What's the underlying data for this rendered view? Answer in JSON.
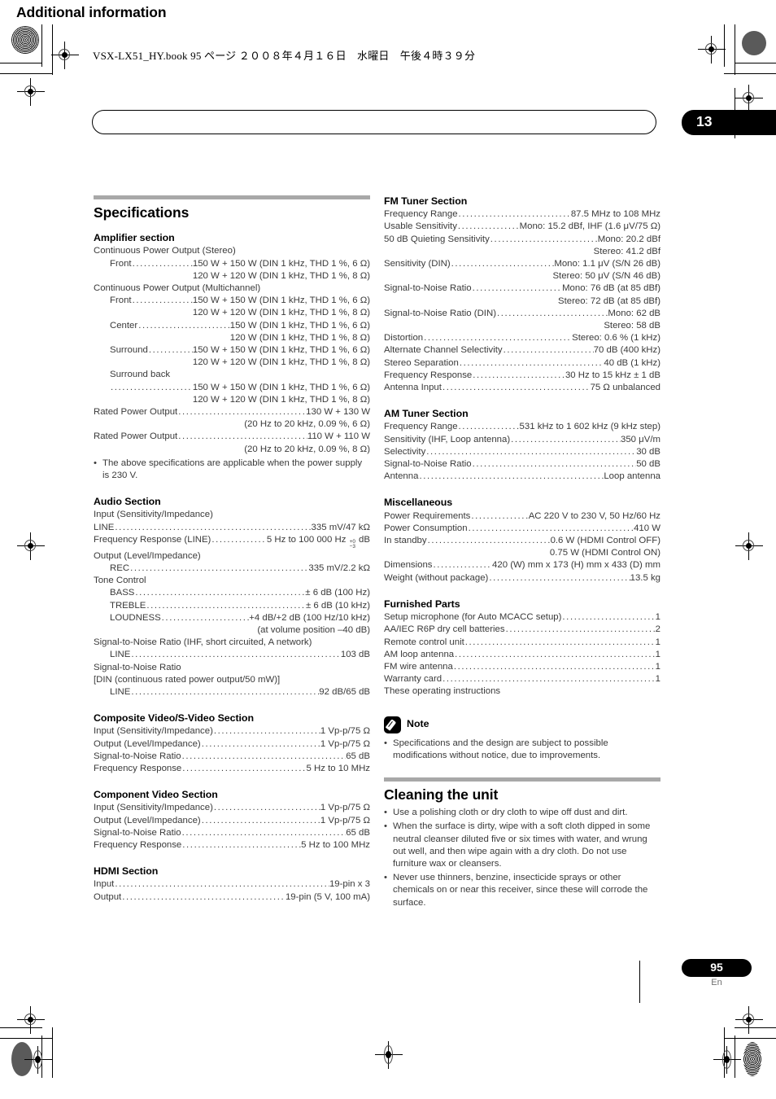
{
  "running_head": "VSX-LX51_HY.book  95 ページ  ２００８年４月１６日　水曜日　午後４時３９分",
  "chapter": {
    "title": "Additional information",
    "number": "13"
  },
  "footer": {
    "page": "95",
    "lang": "En"
  },
  "left_column": {
    "heading": "Specifications",
    "amplifier": {
      "heading": "Amplifier section",
      "lines": [
        {
          "type": "plain",
          "label": "Continuous Power Output (Stereo)"
        },
        {
          "type": "spec",
          "indent": 1,
          "label": "Front",
          "value": "150 W + 150 W (DIN 1 kHz, THD 1 %, 6 Ω)"
        },
        {
          "type": "cont",
          "value": "120 W + 120 W (DIN 1 kHz, THD 1 %, 8 Ω)"
        },
        {
          "type": "plain",
          "label": "Continuous Power Output (Multichannel)"
        },
        {
          "type": "spec",
          "indent": 1,
          "label": "Front",
          "value": "150 W + 150 W (DIN 1 kHz, THD 1 %, 6 Ω)"
        },
        {
          "type": "cont",
          "value": "120 W + 120 W (DIN 1 kHz, THD 1 %, 8 Ω)"
        },
        {
          "type": "spec",
          "indent": 1,
          "label": "Center",
          "value": "150 W (DIN 1 kHz, THD 1 %, 6 Ω)"
        },
        {
          "type": "cont",
          "value": "120 W (DIN 1 kHz, THD 1 %, 8 Ω)"
        },
        {
          "type": "spec",
          "indent": 1,
          "label": "Surround",
          "value": "150 W + 150 W (DIN 1 kHz, THD 1 %, 6 Ω)"
        },
        {
          "type": "cont",
          "value": "120 W + 120 W (DIN 1 kHz, THD 1 %, 8 Ω)"
        },
        {
          "type": "plain",
          "indent": 1,
          "label": "Surround back"
        },
        {
          "type": "spec",
          "indent": 1,
          "label": "",
          "value": "150 W + 150 W (DIN 1 kHz, THD 1 %, 6 Ω)"
        },
        {
          "type": "cont",
          "value": "120 W + 120 W (DIN 1 kHz, THD 1 %, 8 Ω)"
        },
        {
          "type": "spec",
          "label": "Rated Power Output",
          "value": "130 W + 130 W"
        },
        {
          "type": "cont",
          "value": "(20 Hz to 20 kHz, 0.09 %, 6 Ω)"
        },
        {
          "type": "spec",
          "label": "Rated Power Output",
          "value": "110 W + 110 W"
        },
        {
          "type": "cont",
          "value": "(20 Hz to 20 kHz, 0.09 %, 8 Ω)"
        }
      ],
      "bullet": "The above specifications are applicable when the power supply is 230 V."
    },
    "audio": {
      "heading": "Audio Section",
      "lines": [
        {
          "type": "plain",
          "label": "Input (Sensitivity/Impedance)"
        },
        {
          "type": "spec",
          "label": "LINE",
          "value": "335 mV/47 kΩ"
        },
        {
          "type": "spec",
          "label": "Frequency Response (LINE)",
          "value": "5 Hz to 100 000 Hz +0/−3 dB",
          "frac": true,
          "value_pre": "5 Hz to 100 000 Hz ",
          "frac_top": "+0",
          "frac_bot": "−3",
          "value_post": " dB"
        },
        {
          "type": "plain",
          "label": "Output (Level/Impedance)"
        },
        {
          "type": "spec",
          "indent": 1,
          "label": "REC",
          "value": "335 mV/2.2 kΩ"
        },
        {
          "type": "plain",
          "label": "Tone Control"
        },
        {
          "type": "spec",
          "indent": 1,
          "label": "BASS",
          "value": "± 6 dB (100 Hz)"
        },
        {
          "type": "spec",
          "indent": 1,
          "label": "TREBLE",
          "value": "± 6 dB (10 kHz)"
        },
        {
          "type": "spec",
          "indent": 1,
          "label": "LOUDNESS",
          "value": "+4 dB/+2 dB (100 Hz/10 kHz)"
        },
        {
          "type": "cont",
          "value": "(at volume position –40 dB)"
        },
        {
          "type": "plain",
          "label": "Signal-to-Noise Ratio (IHF, short circuited, A network)"
        },
        {
          "type": "spec",
          "indent": 1,
          "label": "LINE",
          "value": "103 dB"
        },
        {
          "type": "plain",
          "label": "Signal-to-Noise Ratio"
        },
        {
          "type": "plain",
          "label": "[DIN (continuous rated power output/50 mW)]"
        },
        {
          "type": "spec",
          "indent": 1,
          "label": "LINE",
          "value": "92 dB/65 dB"
        }
      ]
    },
    "composite": {
      "heading": "Composite Video/S-Video Section",
      "lines": [
        {
          "type": "spec",
          "label": "Input (Sensitivity/Impedance)",
          "value": "1 Vp-p/75 Ω"
        },
        {
          "type": "spec",
          "label": "Output (Level/Impedance)",
          "value": "1 Vp-p/75 Ω"
        },
        {
          "type": "spec",
          "label": "Signal-to-Noise Ratio",
          "value": "65 dB"
        },
        {
          "type": "spec",
          "label": "Frequency Response",
          "value": "5 Hz to 10 MHz"
        }
      ]
    },
    "component": {
      "heading": "Component Video Section",
      "lines": [
        {
          "type": "spec",
          "label": "Input (Sensitivity/Impedance)",
          "value": "1 Vp-p/75 Ω"
        },
        {
          "type": "spec",
          "label": "Output (Level/Impedance)",
          "value": "1 Vp-p/75 Ω"
        },
        {
          "type": "spec",
          "label": "Signal-to-Noise Ratio",
          "value": "65 dB"
        },
        {
          "type": "spec",
          "label": "Frequency Response",
          "value": "5 Hz to 100 MHz"
        }
      ]
    },
    "hdmi": {
      "heading": "HDMI Section",
      "lines": [
        {
          "type": "spec",
          "label": "Input",
          "value": "19-pin x 3"
        },
        {
          "type": "spec",
          "label": "Output",
          "value": "19-pin (5 V, 100 mA)"
        }
      ]
    }
  },
  "right_column": {
    "fm": {
      "heading": "FM Tuner Section",
      "lines": [
        {
          "type": "spec",
          "label": "Frequency Range",
          "value": "87.5 MHz to 108 MHz"
        },
        {
          "type": "spec",
          "label": "Usable Sensitivity",
          "value": "Mono: 15.2 dBf, IHF (1.6 μV/75 Ω)"
        },
        {
          "type": "spec",
          "label": "50 dB Quieting Sensitivity",
          "value": "Mono: 20.2 dBf"
        },
        {
          "type": "cont",
          "value": "Stereo: 41.2 dBf"
        },
        {
          "type": "spec",
          "label": "Sensitivity (DIN)",
          "value": "Mono: 1.1 μV (S/N 26 dB)"
        },
        {
          "type": "cont",
          "value": "Stereo: 50 μV (S/N 46 dB)"
        },
        {
          "type": "spec",
          "label": "Signal-to-Noise Ratio",
          "value": "Mono: 76 dB (at 85 dBf)"
        },
        {
          "type": "cont",
          "value": "Stereo: 72 dB (at 85 dBf)"
        },
        {
          "type": "spec",
          "label": "Signal-to-Noise Ratio (DIN)",
          "value": "Mono: 62 dB"
        },
        {
          "type": "cont",
          "value": "Stereo: 58 dB"
        },
        {
          "type": "spec",
          "label": "Distortion",
          "value": "Stereo: 0.6 % (1 kHz)"
        },
        {
          "type": "spec",
          "label": "Alternate Channel Selectivity",
          "value": "70 dB (400 kHz)"
        },
        {
          "type": "spec",
          "label": "Stereo Separation",
          "value": "40 dB (1 kHz)"
        },
        {
          "type": "spec",
          "label": "Frequency Response",
          "value": "30 Hz to 15 kHz ± 1 dB"
        },
        {
          "type": "spec",
          "label": "Antenna Input",
          "value": "75 Ω unbalanced"
        }
      ]
    },
    "am": {
      "heading": "AM Tuner Section",
      "lines": [
        {
          "type": "spec",
          "label": "Frequency Range",
          "value": "531 kHz to 1 602 kHz (9 kHz step)"
        },
        {
          "type": "spec",
          "label": "Sensitivity (IHF, Loop antenna)",
          "value": "350 μV/m"
        },
        {
          "type": "spec",
          "label": "Selectivity",
          "value": "30 dB"
        },
        {
          "type": "spec",
          "label": "Signal-to-Noise Ratio",
          "value": "50 dB"
        },
        {
          "type": "spec",
          "label": "Antenna",
          "value": "Loop antenna"
        }
      ]
    },
    "misc": {
      "heading": "Miscellaneous",
      "lines": [
        {
          "type": "spec",
          "label": "Power Requirements",
          "value": "AC 220 V to 230 V, 50 Hz/60 Hz"
        },
        {
          "type": "spec",
          "label": "Power Consumption",
          "value": "410 W"
        },
        {
          "type": "spec",
          "label": "In standby",
          "value": "0.6 W (HDMI Control OFF)"
        },
        {
          "type": "cont",
          "value": "0.75 W (HDMI Control ON)"
        },
        {
          "type": "spec",
          "label": "Dimensions",
          "value": "420 (W) mm x 173 (H) mm x 433 (D) mm"
        },
        {
          "type": "spec",
          "label": "Weight (without package)",
          "value": "13.5 kg"
        }
      ]
    },
    "furnished": {
      "heading": "Furnished Parts",
      "lines": [
        {
          "type": "spec",
          "label": "Setup microphone (for Auto MCACC setup)",
          "value": "1"
        },
        {
          "type": "spec",
          "label": "AA/IEC R6P dry cell batteries",
          "value": "2"
        },
        {
          "type": "spec",
          "label": "Remote control unit",
          "value": "1"
        },
        {
          "type": "spec",
          "label": "AM loop antenna",
          "value": "1"
        },
        {
          "type": "spec",
          "label": "FM wire antenna",
          "value": "1"
        },
        {
          "type": "spec",
          "label": "Warranty card",
          "value": "1"
        },
        {
          "type": "plain",
          "label": "These operating instructions"
        }
      ]
    },
    "note": {
      "label": "Note",
      "icon": "pencil-icon",
      "bullets": [
        "Specifications and the design are subject to possible modifications without notice, due to improvements."
      ]
    },
    "cleaning": {
      "heading": "Cleaning the unit",
      "bullets": [
        "Use a polishing cloth or dry cloth to wipe off dust and dirt.",
        "When the surface is dirty, wipe with a soft cloth dipped in some neutral cleanser diluted five or six times with water, and wrung out well, and then wipe again with a dry cloth. Do not use furniture wax or cleansers.",
        "Never use thinners, benzine, insecticide sprays or other chemicals on or near this receiver, since these will corrode the surface."
      ]
    }
  }
}
